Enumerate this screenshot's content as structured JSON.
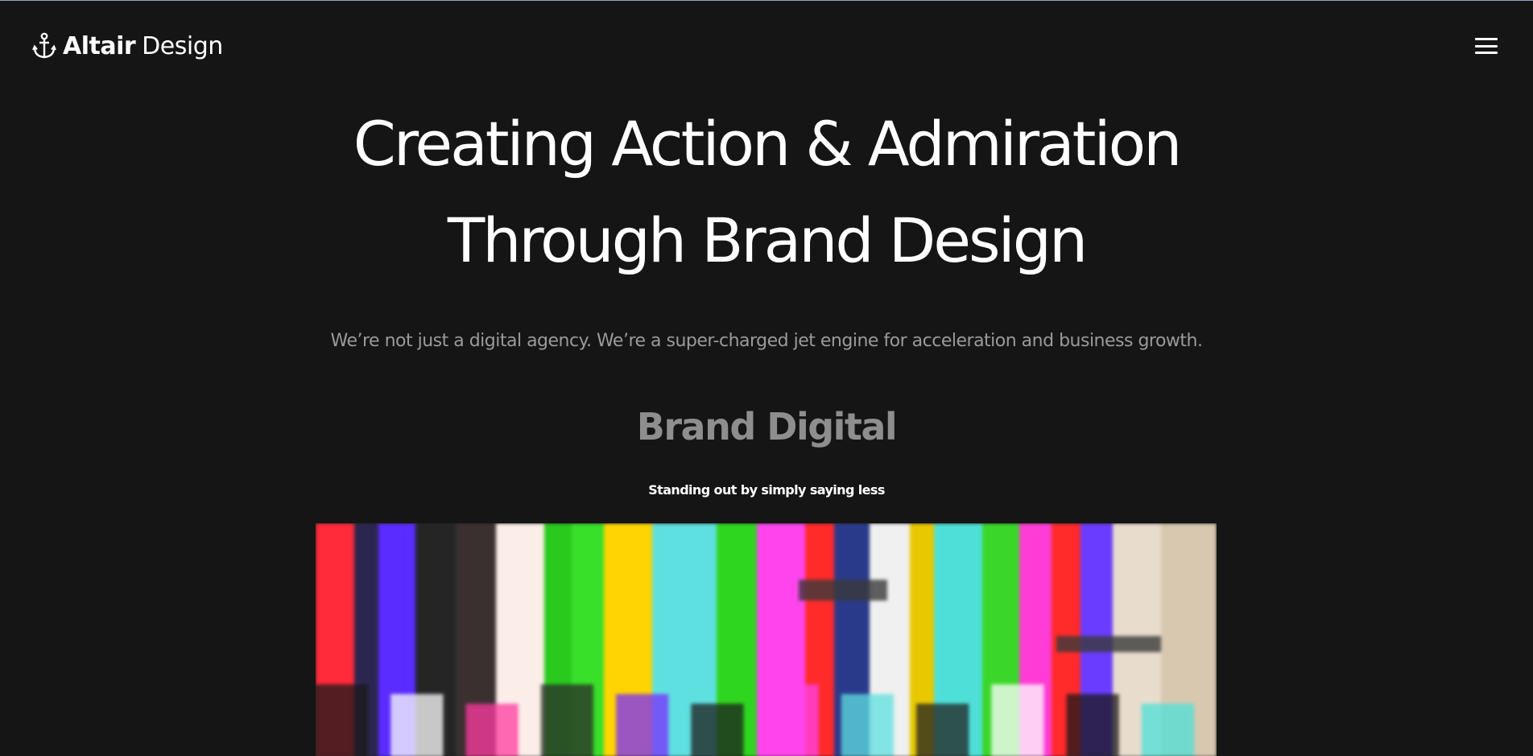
{
  "header": {
    "logo_bold": "Altair",
    "logo_light": "Design",
    "logo_icon": "anchor-icon",
    "menu_icon": "hamburger-menu-icon"
  },
  "hero": {
    "title_line1": "Creating Action & Admiration",
    "title_line2": "Through Brand Design",
    "tagline": "We’re not just a digital agency. We’re a super-charged jet engine for acceleration and business growth."
  },
  "section": {
    "title": "Brand Digital",
    "subtitle": "Standing out by simply saying less"
  },
  "image": {
    "subject": "blurred-tv-color-bars",
    "colors": [
      "#ff2a3a",
      "#2b2650",
      "#5a2cff",
      "#252525",
      "#3a3030",
      "#fbeee8",
      "#29c91e",
      "#39e02a",
      "#ffd400",
      "#5fe0e0",
      "#2fd61f",
      "#ff44ee",
      "#ff2a2a",
      "#2a3a8a",
      "#f0f0f0",
      "#e8c800",
      "#4ee0d8",
      "#3bd62a",
      "#ff3dd6",
      "#ff2a2a",
      "#6a3cff",
      "#e8dccc"
    ]
  },
  "colors": {
    "background": "#151515",
    "text": "#ffffff",
    "muted": "#9a9a9a"
  }
}
